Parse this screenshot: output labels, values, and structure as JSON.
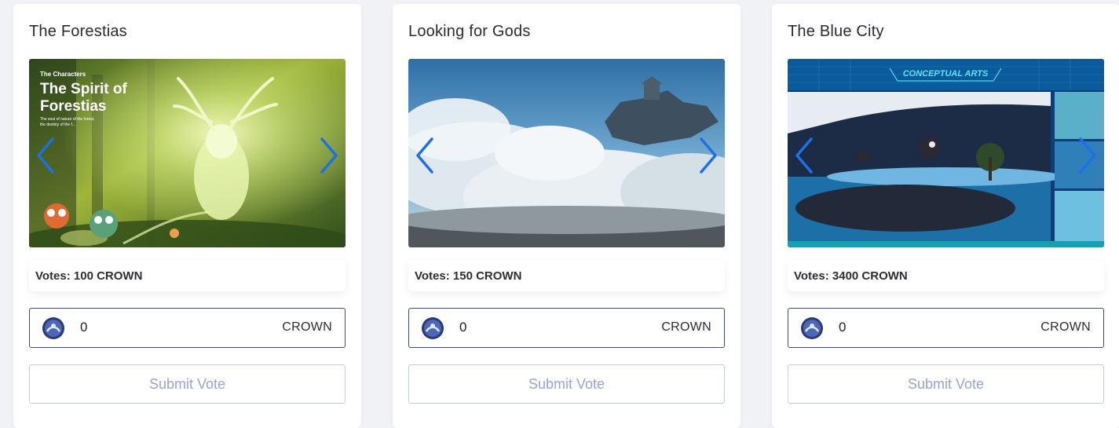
{
  "cards": [
    {
      "title": "The Forestias",
      "image": {
        "kicker": "The Characters",
        "headline_line1": "The Spirit of",
        "headline_line2": "Forestias",
        "caption_line1": "The soul of nature of the forest,",
        "caption_line2": "the destiny of the f..."
      },
      "votes_label": "Votes: 100 CROWN",
      "amount_value": "0",
      "unit": "CROWN",
      "submit_label": "Submit Vote"
    },
    {
      "title": "Looking for Gods",
      "votes_label": "Votes: 150 CROWN",
      "amount_value": "0",
      "unit": "CROWN",
      "submit_label": "Submit Vote"
    },
    {
      "title": "The Blue City",
      "image": {
        "banner": "CONCEPTUAL ARTS"
      },
      "votes_label": "Votes: 3400 CROWN",
      "amount_value": "0",
      "unit": "CROWN",
      "submit_label": "Submit Vote"
    }
  ],
  "colors": {
    "arrow": "#1e6fe8",
    "field_border": "#3e4d86",
    "submit_text": "#98a4d6",
    "submit_border": "#c4cbe4"
  },
  "icons": [
    "chevron-left-icon",
    "chevron-right-icon",
    "crown-coin-icon"
  ]
}
